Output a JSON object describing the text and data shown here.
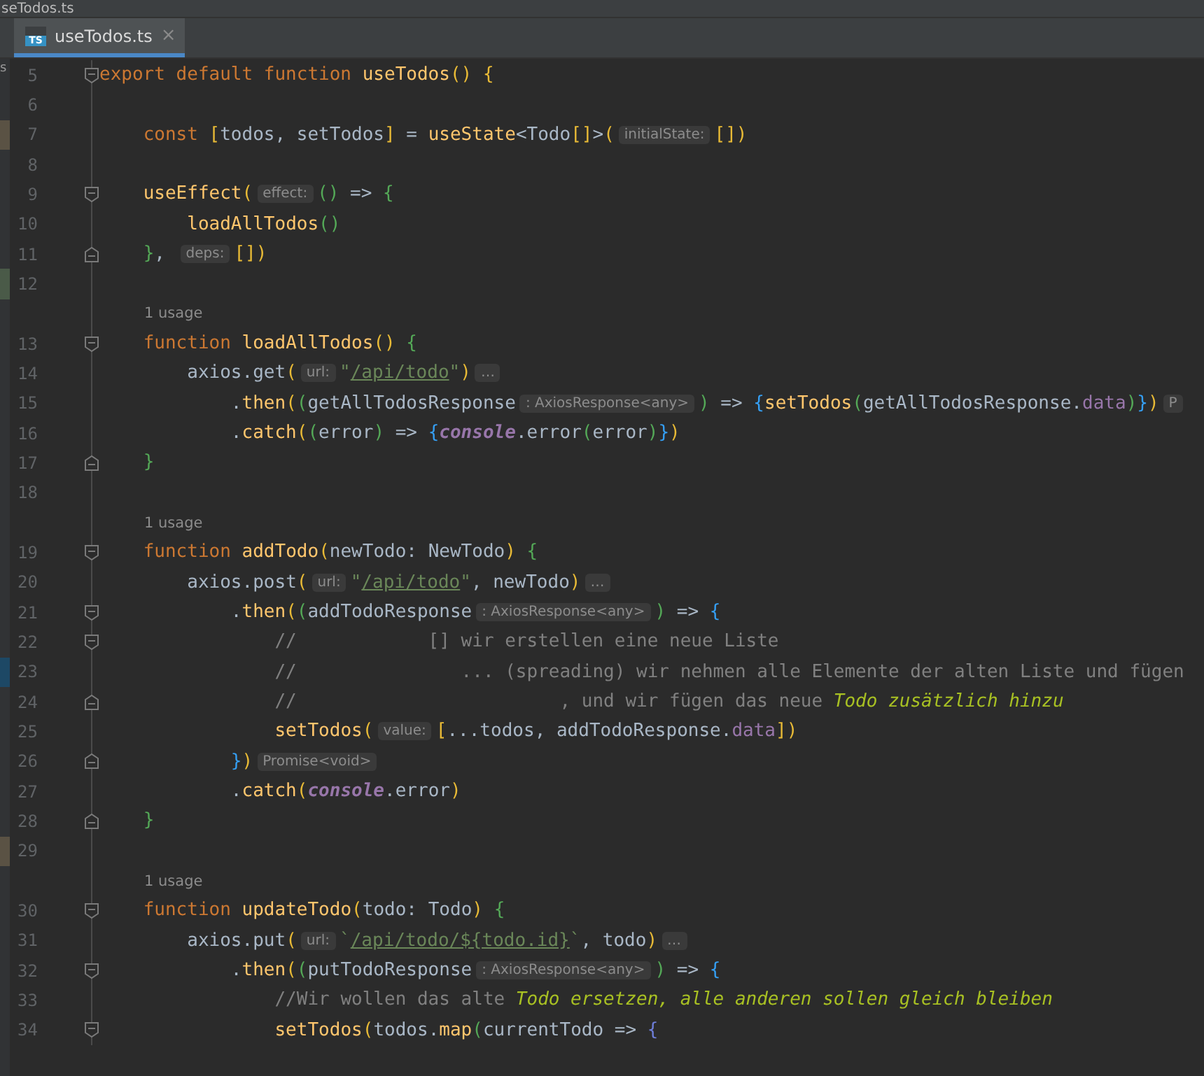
{
  "window": {
    "title": "seTodos.ts"
  },
  "tabs": [
    {
      "label": "useTodos.ts",
      "icon": "TS",
      "close": "×",
      "selected": true
    }
  ],
  "side_panel_fragment": "s",
  "rows": [
    {
      "kind": "code",
      "number": "5",
      "fold": {
        "kind": "start"
      },
      "tokens": [
        {
          "kind": "kw",
          "text": "export default function "
        },
        {
          "kind": "fn",
          "text": "useTodos"
        },
        {
          "kind": "b1",
          "text": "() {"
        }
      ]
    },
    {
      "kind": "code",
      "number": "6",
      "tokens": []
    },
    {
      "kind": "code",
      "number": "7",
      "change": {
        "kind": "modified"
      },
      "tokens": [
        {
          "kind": "kw",
          "text": "    const "
        },
        {
          "kind": "b1",
          "text": "["
        },
        {
          "kind": "p",
          "text": "todos, setTodos"
        },
        {
          "kind": "b1",
          "text": "]"
        },
        {
          "kind": "p",
          "text": " = "
        },
        {
          "kind": "fn",
          "text": "useState"
        },
        {
          "kind": "p",
          "text": "<Todo"
        },
        {
          "kind": "b1",
          "text": "[]"
        },
        {
          "kind": "p",
          "text": ">"
        },
        {
          "kind": "b1",
          "text": "("
        },
        {
          "kind": "hint",
          "text": "initialState:"
        },
        {
          "kind": "b1",
          "text": "[])"
        }
      ]
    },
    {
      "kind": "code",
      "number": "8",
      "tokens": []
    },
    {
      "kind": "code",
      "number": "9",
      "fold": {
        "kind": "start"
      },
      "tokens": [
        {
          "kind": "fn",
          "text": "    useEffect"
        },
        {
          "kind": "b1",
          "text": "("
        },
        {
          "kind": "hint",
          "text": "effect:"
        },
        {
          "kind": "b2",
          "text": "()"
        },
        {
          "kind": "p",
          "text": " => "
        },
        {
          "kind": "b2",
          "text": "{"
        }
      ]
    },
    {
      "kind": "code",
      "number": "10",
      "tokens": [
        {
          "kind": "fn",
          "text": "        loadAllTodos"
        },
        {
          "kind": "b2",
          "text": "()"
        }
      ]
    },
    {
      "kind": "code",
      "number": "11",
      "fold": {
        "kind": "end"
      },
      "tokens": [
        {
          "kind": "b2",
          "text": "    }"
        },
        {
          "kind": "p",
          "text": ", "
        },
        {
          "kind": "hint",
          "text": "deps:"
        },
        {
          "kind": "b1",
          "text": "[])"
        }
      ]
    },
    {
      "kind": "code",
      "number": "12",
      "change": {
        "kind": "added"
      },
      "tokens": []
    },
    {
      "kind": "usage",
      "text": "1 usage"
    },
    {
      "kind": "code",
      "number": "13",
      "fold": {
        "kind": "start"
      },
      "tokens": [
        {
          "kind": "kw",
          "text": "    function "
        },
        {
          "kind": "fn",
          "text": "loadAllTodos"
        },
        {
          "kind": "b1",
          "text": "() "
        },
        {
          "kind": "b2",
          "text": "{"
        }
      ]
    },
    {
      "kind": "code",
      "number": "14",
      "tokens": [
        {
          "kind": "p",
          "text": "        axios.get"
        },
        {
          "kind": "b1",
          "text": "("
        },
        {
          "kind": "hint",
          "text": "url:"
        },
        {
          "kind": "str",
          "text": "\""
        },
        {
          "kind": "link",
          "text": "/api/todo"
        },
        {
          "kind": "str",
          "text": "\""
        },
        {
          "kind": "b1",
          "text": ")"
        },
        {
          "kind": "hint",
          "text": "…"
        }
      ]
    },
    {
      "kind": "code",
      "number": "15",
      "tokens": [
        {
          "kind": "p",
          "text": "            ."
        },
        {
          "kind": "fn",
          "text": "then"
        },
        {
          "kind": "b1",
          "text": "("
        },
        {
          "kind": "b2",
          "text": "("
        },
        {
          "kind": "p",
          "text": "getAllTodosResponse"
        },
        {
          "kind": "hint",
          "text": ": AxiosResponse<any>"
        },
        {
          "kind": "b2",
          "text": ")"
        },
        {
          "kind": "p",
          "text": " => "
        },
        {
          "kind": "b3",
          "text": "{"
        },
        {
          "kind": "fn",
          "text": "setTodos"
        },
        {
          "kind": "b2",
          "text": "("
        },
        {
          "kind": "p",
          "text": "getAllTodosResponse."
        },
        {
          "kind": "prop",
          "text": "data"
        },
        {
          "kind": "b2",
          "text": ")"
        },
        {
          "kind": "b3",
          "text": "}"
        },
        {
          "kind": "b1",
          "text": ")"
        },
        {
          "kind": "hint",
          "text": "P"
        }
      ]
    },
    {
      "kind": "code",
      "number": "16",
      "tokens": [
        {
          "kind": "p",
          "text": "            ."
        },
        {
          "kind": "fn",
          "text": "catch"
        },
        {
          "kind": "b1",
          "text": "("
        },
        {
          "kind": "b2",
          "text": "("
        },
        {
          "kind": "p",
          "text": "error"
        },
        {
          "kind": "b2",
          "text": ")"
        },
        {
          "kind": "p",
          "text": " => "
        },
        {
          "kind": "b3",
          "text": "{"
        },
        {
          "kind": "glob",
          "text": "console"
        },
        {
          "kind": "p",
          "text": ".error"
        },
        {
          "kind": "b2",
          "text": "("
        },
        {
          "kind": "p",
          "text": "error"
        },
        {
          "kind": "b2",
          "text": ")"
        },
        {
          "kind": "b3",
          "text": "}"
        },
        {
          "kind": "b1",
          "text": ")"
        }
      ]
    },
    {
      "kind": "code",
      "number": "17",
      "fold": {
        "kind": "end"
      },
      "tokens": [
        {
          "kind": "b2",
          "text": "    }"
        }
      ]
    },
    {
      "kind": "code",
      "number": "18",
      "tokens": []
    },
    {
      "kind": "usage",
      "text": "1 usage"
    },
    {
      "kind": "code",
      "number": "19",
      "fold": {
        "kind": "start"
      },
      "tokens": [
        {
          "kind": "kw",
          "text": "    function "
        },
        {
          "kind": "fn",
          "text": "addTodo"
        },
        {
          "kind": "b1",
          "text": "("
        },
        {
          "kind": "p",
          "text": "newTodo: NewTodo"
        },
        {
          "kind": "b1",
          "text": ") "
        },
        {
          "kind": "b2",
          "text": "{"
        }
      ]
    },
    {
      "kind": "code",
      "number": "20",
      "tokens": [
        {
          "kind": "p",
          "text": "        axios.post"
        },
        {
          "kind": "b1",
          "text": "("
        },
        {
          "kind": "hint",
          "text": "url:"
        },
        {
          "kind": "str",
          "text": "\""
        },
        {
          "kind": "link",
          "text": "/api/todo"
        },
        {
          "kind": "str",
          "text": "\""
        },
        {
          "kind": "p",
          "text": ", newTodo"
        },
        {
          "kind": "b1",
          "text": ")"
        },
        {
          "kind": "hint",
          "text": "…"
        }
      ]
    },
    {
      "kind": "code",
      "number": "21",
      "fold": {
        "kind": "start"
      },
      "tokens": [
        {
          "kind": "p",
          "text": "            ."
        },
        {
          "kind": "fn",
          "text": "then"
        },
        {
          "kind": "b1",
          "text": "("
        },
        {
          "kind": "b2",
          "text": "("
        },
        {
          "kind": "p",
          "text": "addTodoResponse"
        },
        {
          "kind": "hint",
          "text": ": AxiosResponse<any>"
        },
        {
          "kind": "b2",
          "text": ")"
        },
        {
          "kind": "p",
          "text": " => "
        },
        {
          "kind": "b3",
          "text": "{"
        }
      ]
    },
    {
      "kind": "code",
      "number": "22",
      "fold": {
        "kind": "start"
      },
      "tokens": [
        {
          "kind": "cm",
          "text": "                //            [] wir erstellen eine neue Liste"
        }
      ]
    },
    {
      "kind": "code",
      "number": "23",
      "change": {
        "kind": "current"
      },
      "tokens": [
        {
          "kind": "cm",
          "text": "                //               ... (spreading) wir nehmen alle Elemente der alten Liste und fügen"
        }
      ]
    },
    {
      "kind": "code",
      "number": "24",
      "fold": {
        "kind": "end"
      },
      "tokens": [
        {
          "kind": "cm",
          "text": "                //                        , und wir fügen das neue "
        },
        {
          "kind": "todo",
          "text": "Todo zusätzlich hinzu"
        }
      ]
    },
    {
      "kind": "code",
      "number": "25",
      "tokens": [
        {
          "kind": "fn",
          "text": "                setTodos"
        },
        {
          "kind": "b1",
          "text": "("
        },
        {
          "kind": "hint",
          "text": "value:"
        },
        {
          "kind": "b1",
          "text": "["
        },
        {
          "kind": "p",
          "text": "...todos, addTodoResponse."
        },
        {
          "kind": "prop",
          "text": "data"
        },
        {
          "kind": "b1",
          "text": "])"
        }
      ]
    },
    {
      "kind": "code",
      "number": "26",
      "fold": {
        "kind": "end"
      },
      "tokens": [
        {
          "kind": "b3",
          "text": "            }"
        },
        {
          "kind": "b1",
          "text": ")"
        },
        {
          "kind": "hint",
          "text": "Promise<void>"
        }
      ]
    },
    {
      "kind": "code",
      "number": "27",
      "tokens": [
        {
          "kind": "p",
          "text": "            ."
        },
        {
          "kind": "fn",
          "text": "catch"
        },
        {
          "kind": "b1",
          "text": "("
        },
        {
          "kind": "glob",
          "text": "console"
        },
        {
          "kind": "p",
          "text": ".error"
        },
        {
          "kind": "b1",
          "text": ")"
        }
      ]
    },
    {
      "kind": "code",
      "number": "28",
      "fold": {
        "kind": "end"
      },
      "tokens": [
        {
          "kind": "b2",
          "text": "    }"
        }
      ]
    },
    {
      "kind": "code",
      "number": "29",
      "change": {
        "kind": "modified"
      },
      "tokens": []
    },
    {
      "kind": "usage",
      "text": "1 usage"
    },
    {
      "kind": "code",
      "number": "30",
      "fold": {
        "kind": "start"
      },
      "tokens": [
        {
          "kind": "kw",
          "text": "    function "
        },
        {
          "kind": "fn",
          "text": "updateTodo"
        },
        {
          "kind": "b1",
          "text": "("
        },
        {
          "kind": "p",
          "text": "todo: Todo"
        },
        {
          "kind": "b1",
          "text": ") "
        },
        {
          "kind": "b2",
          "text": "{"
        }
      ]
    },
    {
      "kind": "code",
      "number": "31",
      "tokens": [
        {
          "kind": "p",
          "text": "        axios.put"
        },
        {
          "kind": "b1",
          "text": "("
        },
        {
          "kind": "hint",
          "text": "url:"
        },
        {
          "kind": "str",
          "text": "`"
        },
        {
          "kind": "link",
          "text": "/api/todo/${todo.id}"
        },
        {
          "kind": "str",
          "text": "`"
        },
        {
          "kind": "p",
          "text": ", todo"
        },
        {
          "kind": "b1",
          "text": ")"
        },
        {
          "kind": "hint",
          "text": "…"
        }
      ]
    },
    {
      "kind": "code",
      "number": "32",
      "fold": {
        "kind": "start"
      },
      "tokens": [
        {
          "kind": "p",
          "text": "            ."
        },
        {
          "kind": "fn",
          "text": "then"
        },
        {
          "kind": "b1",
          "text": "("
        },
        {
          "kind": "b2",
          "text": "("
        },
        {
          "kind": "p",
          "text": "putTodoResponse"
        },
        {
          "kind": "hint",
          "text": ": AxiosResponse<any>"
        },
        {
          "kind": "b2",
          "text": ")"
        },
        {
          "kind": "p",
          "text": " => "
        },
        {
          "kind": "b3",
          "text": "{"
        }
      ]
    },
    {
      "kind": "code",
      "number": "33",
      "tokens": [
        {
          "kind": "cm",
          "text": "                //Wir wollen das alte "
        },
        {
          "kind": "todo",
          "text": "Todo ersetzen, alle anderen sollen gleich bleiben"
        }
      ]
    },
    {
      "kind": "code",
      "number": "34",
      "fold": {
        "kind": "start"
      },
      "tokens": [
        {
          "kind": "fn",
          "text": "                setTodos"
        },
        {
          "kind": "b1",
          "text": "("
        },
        {
          "kind": "p",
          "text": "todos."
        },
        {
          "kind": "fn",
          "text": "map"
        },
        {
          "kind": "b2",
          "text": "("
        },
        {
          "kind": "p",
          "text": "currentTodo => "
        },
        {
          "kind": "b4",
          "text": "{"
        }
      ]
    }
  ]
}
